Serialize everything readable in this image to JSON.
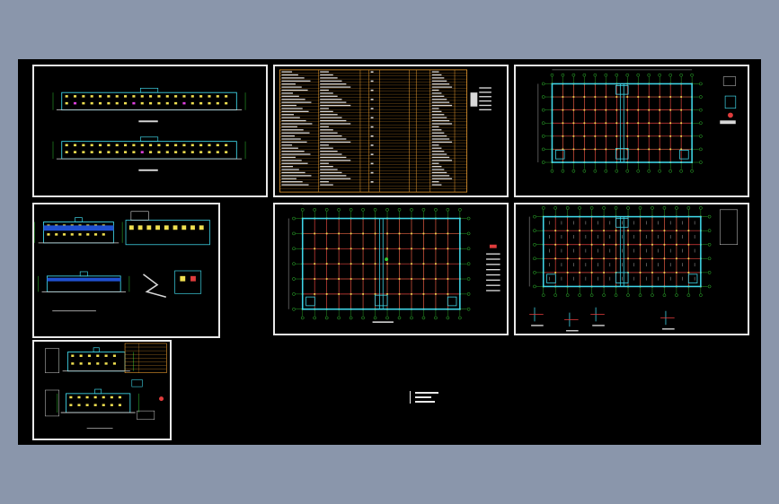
{
  "colors": {
    "background": "#8a96ab",
    "canvas": "#000000",
    "frame": "#e9e9e9",
    "grid_red": "#e03c3c",
    "axis_green": "#32c832",
    "wall_cyan": "#3fd6e8",
    "table_orange": "#f0a030",
    "window_yellow": "#f0e050",
    "window_magenta": "#e040e0",
    "dim_white": "#d8d8d8"
  },
  "sheets": [
    {
      "id": "elevations-front-rear"
    },
    {
      "id": "design-notes-table"
    },
    {
      "id": "floor-plan-1"
    },
    {
      "id": "side-elevations-details"
    },
    {
      "id": "floor-plan-2"
    },
    {
      "id": "roof-plan-details"
    },
    {
      "id": "section-drawings"
    }
  ],
  "note": {
    "line1": "",
    "line2": ""
  }
}
